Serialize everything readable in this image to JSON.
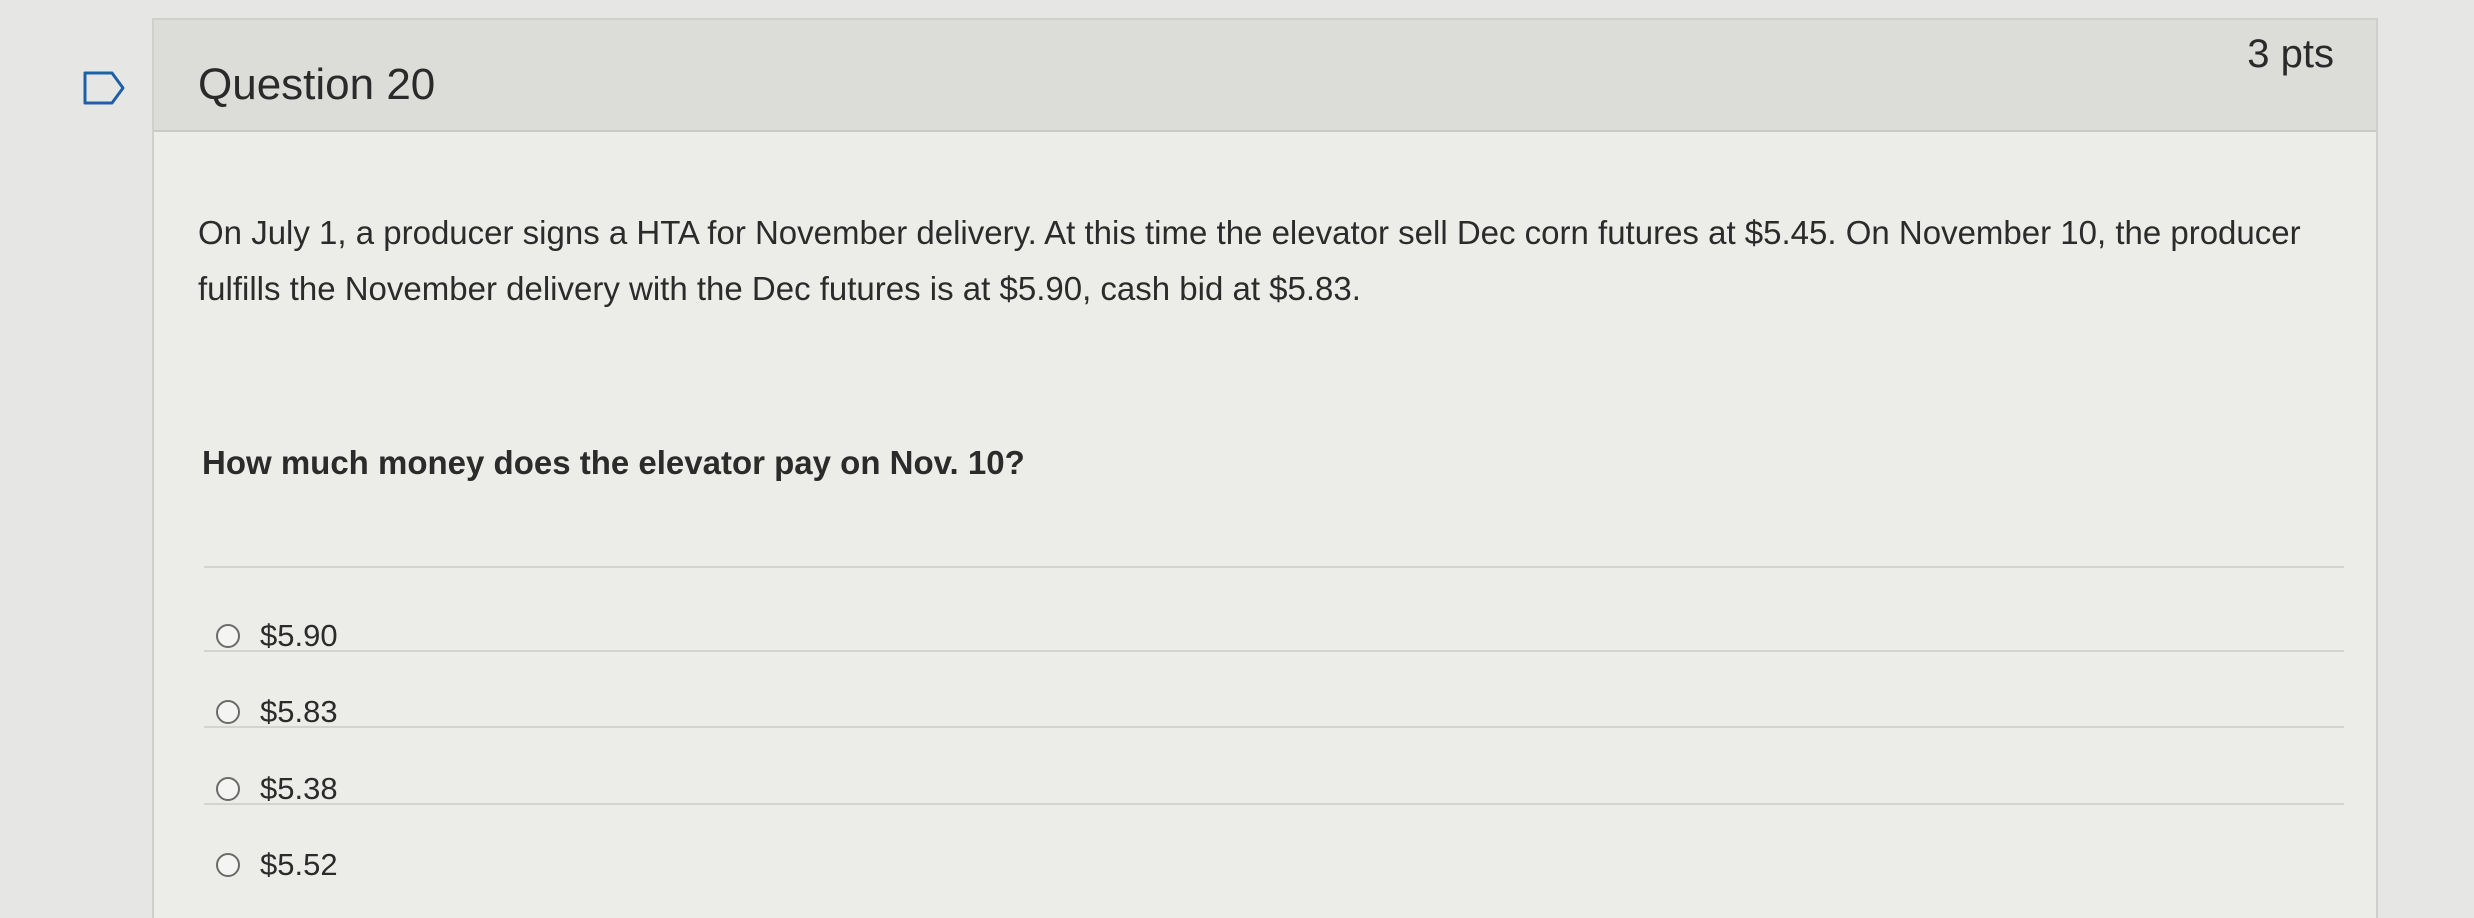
{
  "question": {
    "title": "Question 20",
    "points": "3 pts",
    "flag_icon": "flag-outline-icon",
    "text": "On July 1, a producer signs a HTA for November delivery. At this time the elevator sell Dec corn futures at $5.45. On November 10, the producer fulfills the November delivery with the Dec futures is at $5.90, cash bid at $5.83.",
    "prompt": "How much money does the elevator pay on Nov. 10?",
    "answers": [
      {
        "label": "$5.90",
        "selected": false
      },
      {
        "label": "$5.83",
        "selected": false
      },
      {
        "label": "$5.38",
        "selected": false
      },
      {
        "label": "$5.52",
        "selected": false
      }
    ]
  }
}
